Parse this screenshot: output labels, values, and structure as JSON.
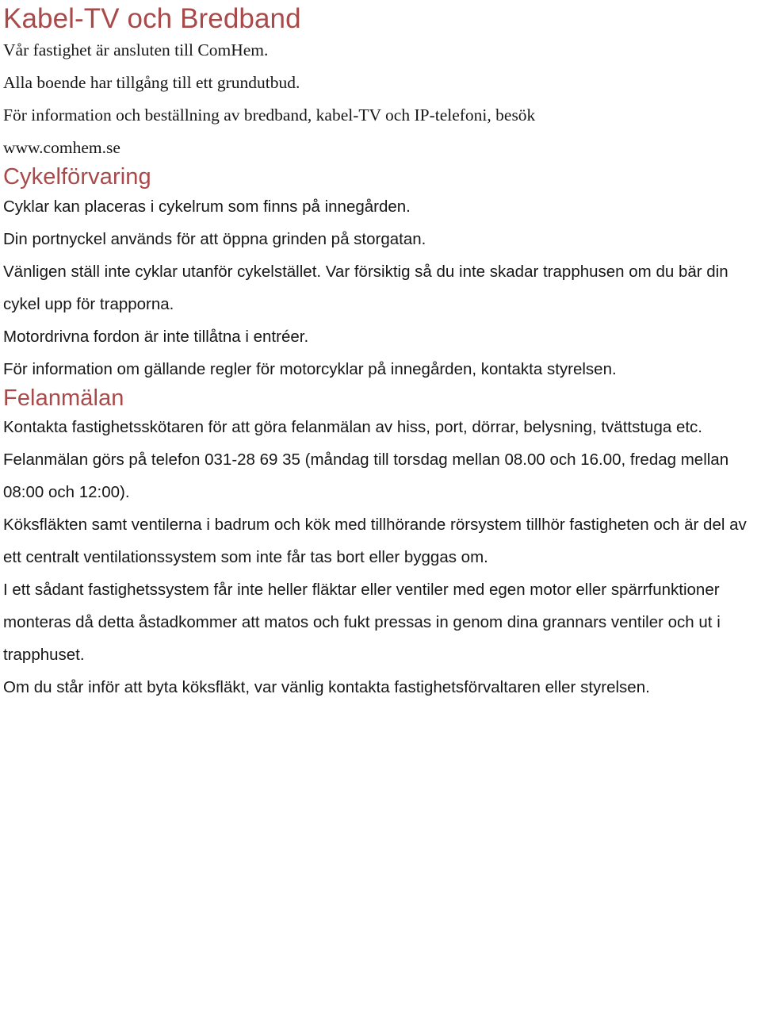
{
  "document": {
    "heading_color": "#a8494a",
    "body_color": "#171717",
    "background": "#ffffff"
  },
  "sections": [
    {
      "id": "kabel-tv",
      "heading": "Kabel-TV och Bredband",
      "paragraphs": [
        "Vår fastighet är ansluten till ComHem.",
        "Alla boende har tillgång till ett grundutbud.",
        "För information och beställning av bredband, kabel-TV och IP-telefoni, besök",
        "www.comhem.se"
      ]
    },
    {
      "id": "cykelforvaring",
      "heading": "Cykelförvaring",
      "paragraphs": [
        "Cyklar kan placeras i cykelrum som finns på innegården.",
        "Din portnyckel används för att öppna grinden på storgatan.",
        "Vänligen ställ inte cyklar utanför cykelstället. Var försiktig så du inte skadar trapphusen om du bär din cykel upp för trapporna.",
        "Motordrivna fordon är inte tillåtna i entréer.",
        "För information om gällande regler för motorcyklar på innegården, kontakta styrelsen."
      ]
    },
    {
      "id": "felanmalan",
      "heading": "Felanmälan",
      "paragraphs": [
        "Kontakta fastighetsskötaren för att göra felanmälan av hiss, port, dörrar, belysning, tvättstuga etc. Felanmälan görs på telefon 031-28 69 35 (måndag till torsdag mellan 08.00 och 16.00, fredag mellan 08:00 och 12:00).",
        "Köksfläkten samt ventilerna i badrum och kök med tillhörande rörsystem tillhör fastigheten och är del av ett centralt ventilationssystem som inte får tas bort eller byggas om.",
        "I ett sådant fastighetssystem får inte heller fläktar eller ventiler med egen motor eller spärrfunktioner monteras då detta åstadkommer att matos och fukt pressas in genom dina grannars ventiler och ut i trapphuset.",
        "Om du står inför att byta köksfläkt, var vänlig kontakta fastighetsförvaltaren eller styrelsen."
      ]
    }
  ],
  "contact": {
    "phone": "031-28 69 35",
    "website": "www.comhem.se",
    "hours_weekday": "måndag till torsdag mellan 08.00 och 16.00",
    "hours_friday": "fredag mellan 08:00 och 12:00"
  }
}
